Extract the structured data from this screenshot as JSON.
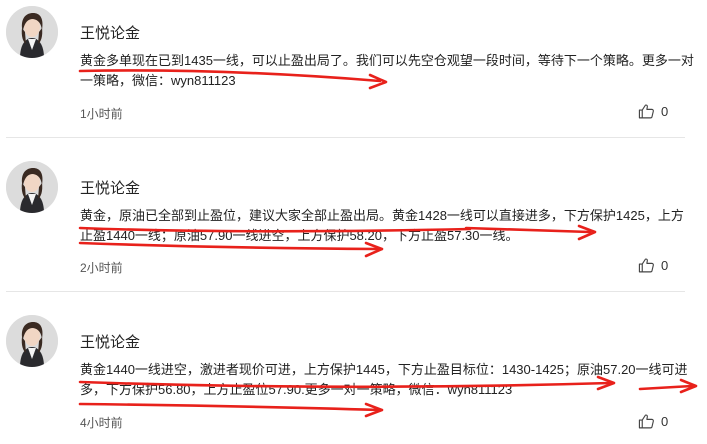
{
  "colors": {
    "annotation_red": "#e8211b",
    "divider": "#e6e6e6",
    "meta_text": "#555555"
  },
  "posts": [
    {
      "author": "王悦论金",
      "content": "黄金多单现在已到1435一线，可以止盈出局了。我们可以先空仓观望一段时间，等待下一个策略。更多一对一策略，微信：wyn811123",
      "time": "1小时前",
      "likes": "0",
      "like_icon": "thumbs-up-icon",
      "avatar_icon": "avatar-photo"
    },
    {
      "author": "王悦论金",
      "content": "黄金，原油已全部到止盈位，建议大家全部止盈出局。黄金1428一线可以直接进多，下方保护1425，上方止盈1440一线；原油57.90一线进空，上方保护58.20，下方止盈57.30一线。",
      "time": "2小时前",
      "likes": "0",
      "like_icon": "thumbs-up-icon",
      "avatar_icon": "avatar-photo"
    },
    {
      "author": "王悦论金",
      "content": "黄金1440一线进空，激进者现价可进，上方保护1445，下方止盈目标位：1430-1425；原油57.20一线可进多，下方保护56.80，上方止盈位57.90.更多一对一策略，微信：wyn811123",
      "time": "4小时前",
      "likes": "0",
      "like_icon": "thumbs-up-icon",
      "avatar_icon": "avatar-photo"
    }
  ]
}
